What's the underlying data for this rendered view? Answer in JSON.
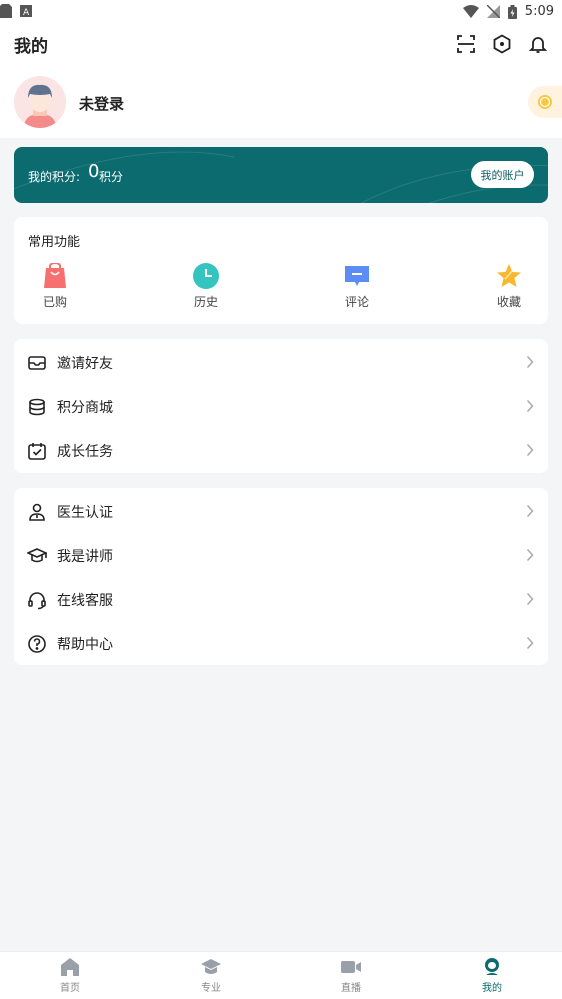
{
  "status_bar": {
    "time": "5:09"
  },
  "header": {
    "title": "我的"
  },
  "profile": {
    "name": "未登录"
  },
  "points": {
    "label": "我的积分:",
    "value": "0",
    "unit": "积分",
    "account_button": "我的账户"
  },
  "functions": {
    "title": "常用功能",
    "items": [
      {
        "label": "已购",
        "icon": "shopping-bag-icon"
      },
      {
        "label": "历史",
        "icon": "clock-icon"
      },
      {
        "label": "评论",
        "icon": "comment-icon"
      },
      {
        "label": "收藏",
        "icon": "star-icon"
      }
    ]
  },
  "group1": [
    {
      "label": "邀请好友",
      "icon": "invite-icon"
    },
    {
      "label": "积分商城",
      "icon": "coins-stack-icon"
    },
    {
      "label": "成长任务",
      "icon": "calendar-check-icon"
    }
  ],
  "group2": [
    {
      "label": "医生认证",
      "icon": "doctor-icon"
    },
    {
      "label": "我是讲师",
      "icon": "graduation-cap-icon"
    },
    {
      "label": "在线客服",
      "icon": "headset-icon"
    },
    {
      "label": "帮助中心",
      "icon": "help-circle-icon"
    }
  ],
  "tabs": [
    {
      "label": "首页",
      "icon": "home-icon"
    },
    {
      "label": "专业",
      "icon": "graduation-cap-icon"
    },
    {
      "label": "直播",
      "icon": "video-camera-icon"
    },
    {
      "label": "我的",
      "icon": "user-icon",
      "active": true
    }
  ],
  "colors": {
    "brand": "#0b6b6e",
    "background": "#f4f5f7"
  }
}
